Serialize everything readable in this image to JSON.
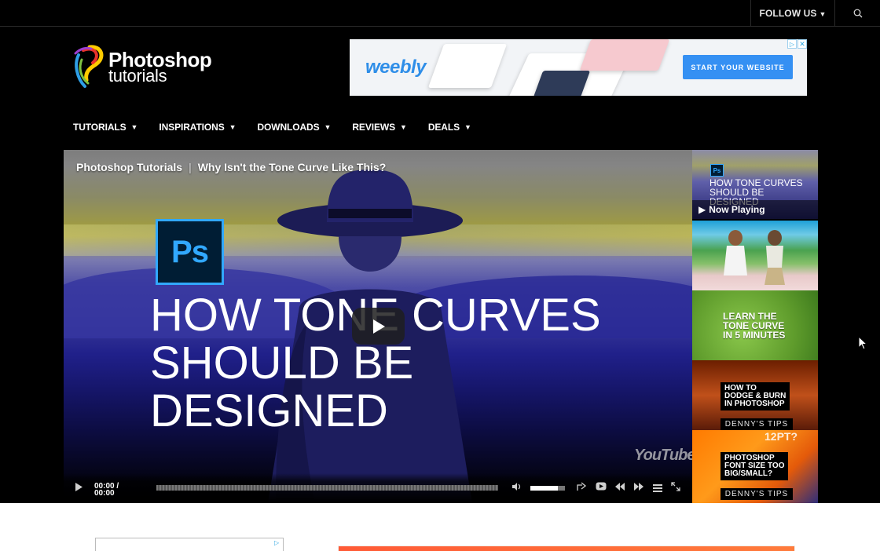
{
  "topbar": {
    "follow_label": "FOLLOW US",
    "search_icon": "search-icon"
  },
  "logo": {
    "line1": "Photoshop",
    "line2": "tutorials"
  },
  "banner_ad": {
    "brand": "weebly",
    "cta": "START YOUR WEBSITE",
    "adchoices_icon": "adchoices-icon",
    "close_icon": "close-icon"
  },
  "nav": {
    "items": [
      {
        "label": "TUTORIALS"
      },
      {
        "label": "INSPIRATIONS"
      },
      {
        "label": "DOWNLOADS"
      },
      {
        "label": "REVIEWS"
      },
      {
        "label": "DEALS"
      }
    ]
  },
  "video": {
    "channel": "Photoshop Tutorials",
    "separator": "|",
    "title": "Why Isn't the Tone Curve Like This?",
    "ps_badge": "Ps",
    "overlay_line1": "HOW TONE CURVES",
    "overlay_line2": "SHOULD BE",
    "overlay_line3": "DESIGNED",
    "watermark": "YouTube",
    "time_current": "00:00",
    "time_sep": "/",
    "time_total": "00:00",
    "volume_level": 0.8,
    "progress": 0.0
  },
  "playlist": {
    "items": [
      {
        "badge": "Ps",
        "title_l1": "HOW TONE CURVES",
        "title_l2": "SHOULD BE",
        "title_l3": "DESIGNED",
        "status": "Now Playing"
      },
      {
        "title": ""
      },
      {
        "l1": "LEARN THE",
        "l2": "TONE CURVE",
        "l3": "IN 5 MINUTES"
      },
      {
        "l1": "HOW TO",
        "l2": "DODGE & BURN",
        "l3": "IN PHOTOSHOP",
        "tag": "DENNY'S TIPS"
      },
      {
        "q1": "12PT?",
        "l1": "PHOTOSHOP",
        "l2": "FONT SIZE TOO",
        "l3": "BIG/SMALL?",
        "tag": "DENNY'S TIPS"
      }
    ]
  },
  "colors": {
    "background": "#000000",
    "ad_cta": "#3590f3",
    "ps_blue": "#31a8ff"
  }
}
